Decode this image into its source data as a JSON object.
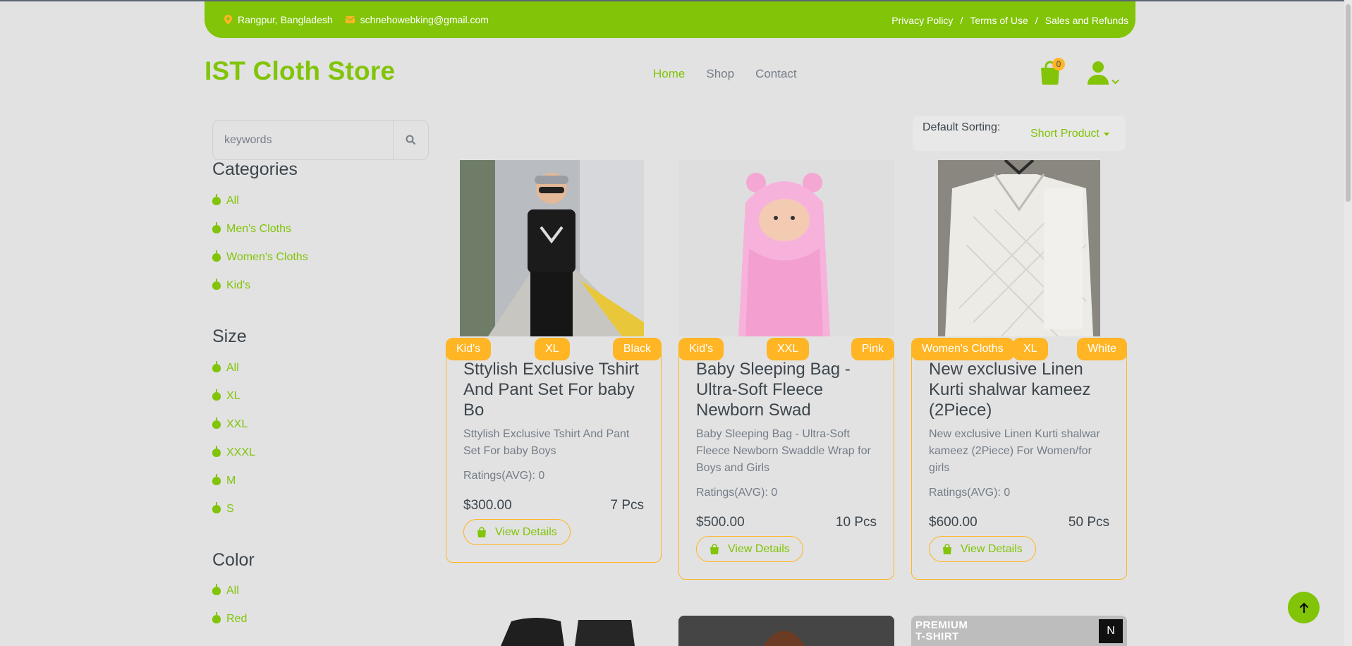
{
  "topbar": {
    "location": "Rangpur, Bangladesh",
    "email": "schnehowebking@gmail.com",
    "links": [
      "Privacy Policy",
      "Terms of Use",
      "Sales and Refunds"
    ],
    "separator": "/"
  },
  "header": {
    "logo": "IST Cloth Store",
    "nav": [
      "Home",
      "Shop",
      "Contact"
    ],
    "cart_count": "0"
  },
  "search": {
    "placeholder": "keywords"
  },
  "sidebar": {
    "categories_title": "Categories",
    "categories": [
      "All",
      "Men's Cloths",
      "Women's Cloths",
      "Kid's"
    ],
    "size_title": "Size",
    "sizes": [
      "All",
      "XL",
      "XXL",
      "XXXL",
      "M",
      "S"
    ],
    "color_title": "Color",
    "colors": [
      "All",
      "Red"
    ]
  },
  "sorting": {
    "label": "Default Sorting:",
    "value": "Short Product"
  },
  "products": [
    {
      "category": "Kid's",
      "size": "XL",
      "color": "Black",
      "title": "Sttylish Exclusive Tshirt And Pant Set For baby Bo",
      "description": "Sttylish Exclusive Tshirt And Pant Set For baby Boys",
      "rating": "Ratings(AVG): 0",
      "price": "$300.00",
      "stock": "7 Pcs",
      "button": "View Details"
    },
    {
      "category": "Kid's",
      "size": "XXL",
      "color": "Pink",
      "title": "Baby Sleeping Bag - Ultra-Soft Fleece Newborn Swad",
      "description": "Baby Sleeping Bag - Ultra-Soft Fleece Newborn Swaddle Wrap for Boys and Girls",
      "rating": "Ratings(AVG): 0",
      "price": "$500.00",
      "stock": "10 Pcs",
      "button": "View Details"
    },
    {
      "category": "Women's Cloths",
      "size": "XL",
      "color": "White",
      "title": "New exclusive Linen Kurti shalwar kameez (2Piece)",
      "description": "New exclusive Linen Kurti shalwar kameez (2Piece) For Women/for girls",
      "rating": "Ratings(AVG): 0",
      "price": "$600.00",
      "stock": "50 Pcs",
      "button": "View Details"
    }
  ],
  "partial_banner": {
    "text": "PREMIUM T-SHIRT"
  },
  "colors": {
    "primary": "#81c408",
    "accent": "#ffb524",
    "text": "#3d464d",
    "muted": "#747d88"
  }
}
